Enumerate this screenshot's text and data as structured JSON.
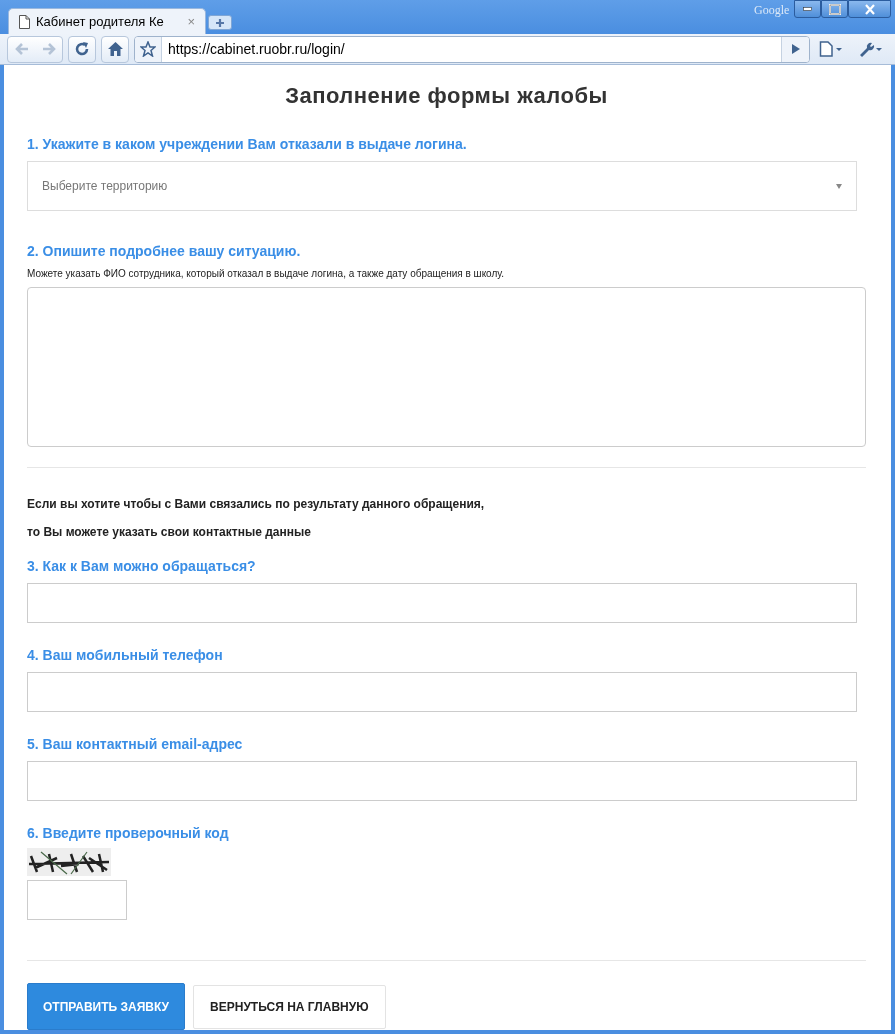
{
  "browser": {
    "brand": "Google",
    "tab_title": "Кабинет родителя Ке",
    "tab_close": "×",
    "url": "https://cabinet.ruobr.ru/login/"
  },
  "form": {
    "title": "Заполнение формы жалобы",
    "fields": [
      {
        "kind": "select",
        "label": "1. Укажите в каком учреждении Вам отказали в выдаче логина.",
        "placeholder": "Выберите территорию"
      },
      {
        "kind": "textarea",
        "label": "2. Опишите подробнее вашу ситуацию.",
        "hint": "Можете указать ФИО сотрудника, который отказал в выдаче логина, а также дату обращения в школу."
      },
      {
        "kind": "divider"
      },
      {
        "kind": "note",
        "lines": [
          "Если вы хотите чтобы с Вами связались по результату данного обращения,",
          "то Вы можете указать свои контактные данные"
        ]
      },
      {
        "kind": "input",
        "label": "3. Как к Вам можно обращаться?"
      },
      {
        "kind": "input",
        "label": "4. Ваш мобильный телефон"
      },
      {
        "kind": "input",
        "label": "5. Ваш контактный email-адрес"
      },
      {
        "kind": "captcha",
        "label": "6. Введите проверочный код"
      },
      {
        "kind": "divider"
      }
    ],
    "buttons": [
      {
        "label": "ОТПРАВИТЬ ЗАЯВКУ",
        "primary": true
      },
      {
        "label": "ВЕРНУТЬСЯ НА ГЛАВНУЮ",
        "primary": false
      }
    ]
  }
}
